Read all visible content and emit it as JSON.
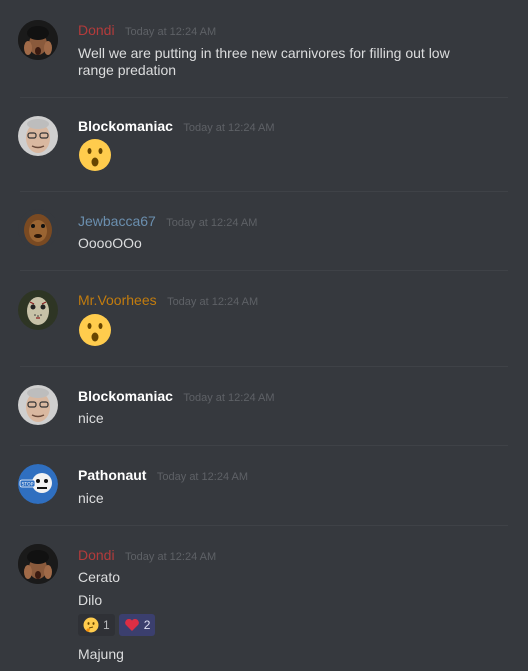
{
  "messages": [
    {
      "author": "Dondi",
      "author_color": "#b33b3b",
      "time": "Today at 12:24 AM",
      "lines": [
        "Well we are putting in three new carnivores for filling out low",
        "range predation"
      ]
    },
    {
      "author": "Blockomaniac",
      "author_color": "#ffffff",
      "time": "Today at 12:24 AM",
      "emoji": "hushed-face"
    },
    {
      "author": "Jewbacca67",
      "author_color": "#6b8faf",
      "time": "Today at 12:24 AM",
      "lines": [
        "OoooOOo"
      ]
    },
    {
      "author": "Mr.Voorhees",
      "author_color": "#c27c0e",
      "time": "Today at 12:24 AM",
      "emoji": "hushed-face"
    },
    {
      "author": "Blockomaniac",
      "author_color": "#ffffff",
      "time": "Today at 12:24 AM",
      "lines": [
        "nice"
      ]
    },
    {
      "author": "Pathonaut",
      "author_color": "#ffffff",
      "time": "Today at 12:24 AM",
      "lines": [
        "nice"
      ]
    },
    {
      "author": "Dondi",
      "author_color": "#b33b3b",
      "time": "Today at 12:24 AM",
      "lines": [
        "Cerato",
        "Dilo",
        "Majung"
      ],
      "reactions": [
        {
          "emoji": "thinking-face",
          "count": "1",
          "active": false
        },
        {
          "emoji": "red-heart",
          "count": "2",
          "active": true
        }
      ]
    }
  ]
}
